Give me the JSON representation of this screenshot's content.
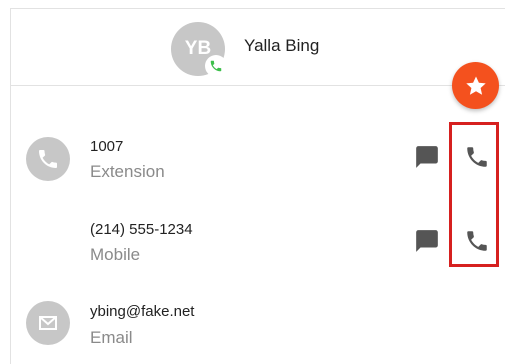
{
  "contact": {
    "initials": "YB",
    "name": "Yalla Bing"
  },
  "icons": {
    "presence": "phone-icon",
    "favorite": "star-icon",
    "extension": "phone-icon",
    "email": "mail-icon",
    "message": "message-icon",
    "call": "phone-icon"
  },
  "rows": [
    {
      "value": "1007",
      "label": "Extension"
    },
    {
      "value": "(214) 555-1234",
      "label": "Mobile"
    },
    {
      "value": "ybing@fake.net",
      "label": "Email"
    }
  ],
  "colors": {
    "favorite": "#f4511e",
    "presence": "#3dbf4b",
    "highlight": "#d6201f",
    "icon_gray": "#555555"
  }
}
